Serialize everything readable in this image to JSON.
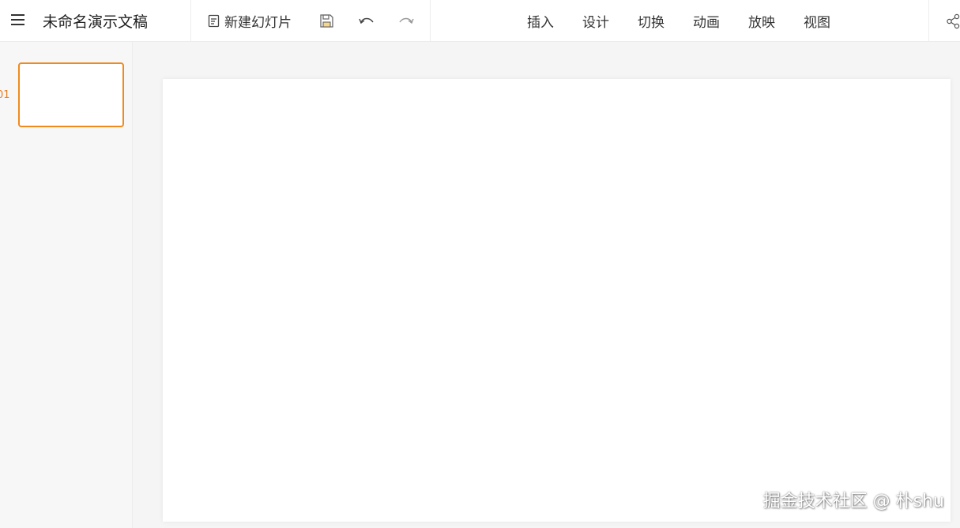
{
  "header": {
    "doc_title": "未命名演示文稿",
    "new_slide_label": "新建幻灯片",
    "tabs": [
      "插入",
      "设计",
      "切换",
      "动画",
      "放映",
      "视图"
    ]
  },
  "sidebar": {
    "slides": [
      {
        "number": "01"
      }
    ]
  },
  "watermark": "掘金技术社区 @ 朴shu",
  "colors": {
    "accent": "#f08a1c",
    "sidebar_bg": "#f7f7f7",
    "canvas_bg": "#f5f5f5"
  }
}
